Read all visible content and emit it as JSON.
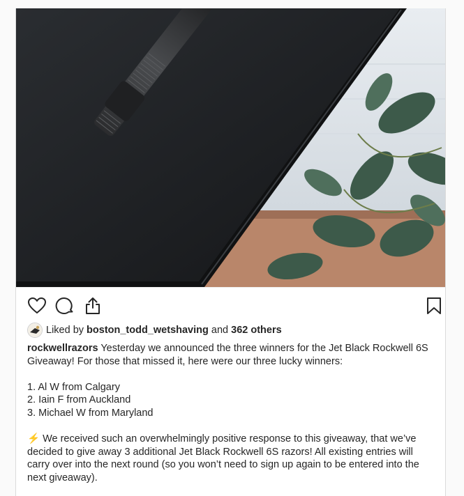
{
  "post": {
    "likes": {
      "prefix": "Liked by",
      "user": "boston_todd_wetshaving",
      "joiner": "and",
      "others": "362 others"
    },
    "caption": {
      "username": "rockwellrazors",
      "intro": "Yesterday we announced the three winners for the Jet Black Rockwell 6S Giveaway! For those that missed it, here were our three lucky winners:",
      "winners": [
        "1. Al W from Calgary",
        "2. Iain F from Auckland",
        "3. Michael W from Maryland"
      ],
      "bolt_emoji": "⚡",
      "followup": "We received such an overwhelmingly positive response to this giveaway, that we’ve decided to give away 3 additional Jet Black Rockwell 6S razors! All existing entries will carry over into the next round (so you won’t need to sign up again to be entered into the next giveaway)."
    }
  },
  "icons": {
    "like": "heart-icon",
    "comment": "comment-icon",
    "share": "share-icon",
    "save": "bookmark-icon"
  },
  "colors": {
    "text": "#262626",
    "bolt": "#f5b400"
  }
}
